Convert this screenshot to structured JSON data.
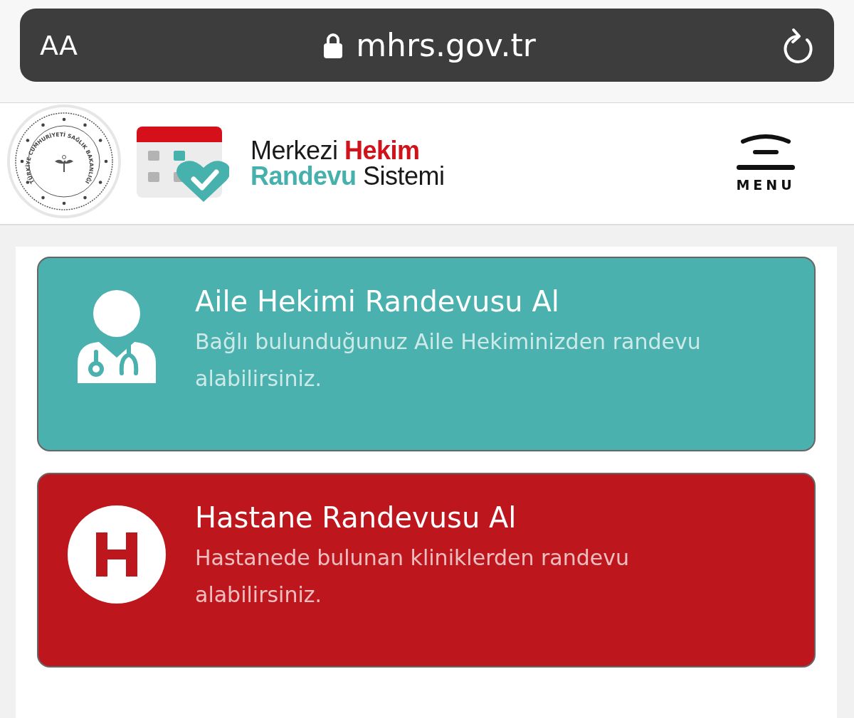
{
  "address_bar": {
    "text_size_button": "AA",
    "url": "mhrs.gov.tr"
  },
  "header": {
    "seal_text": "TÜRKİYE CUMHURİYETİ SAĞLIK BAKANLIĞI",
    "logo_lines": [
      [
        {
          "text": "Merkezi ",
          "color": "#1a1a1a"
        },
        {
          "text": "Hekim",
          "color": "#d0121b"
        }
      ],
      [
        {
          "text": "Randevu",
          "color": "#45b0ac"
        },
        {
          "text": " Sistemi",
          "color": "#1a1a1a"
        }
      ]
    ],
    "menu_label": "MENU"
  },
  "cards": [
    {
      "kind": "doctor",
      "color": "#4bb1ae",
      "title": "Aile Hekimi Randevusu Al",
      "description": "Bağlı bulunduğunuz Aile Hekiminizden randevu alabilirsiniz."
    },
    {
      "kind": "hospital",
      "color": "#be161d",
      "title": "Hastane Randevusu Al",
      "description": "Hastanede bulunan kliniklerden randevu alabilirsiniz."
    }
  ]
}
